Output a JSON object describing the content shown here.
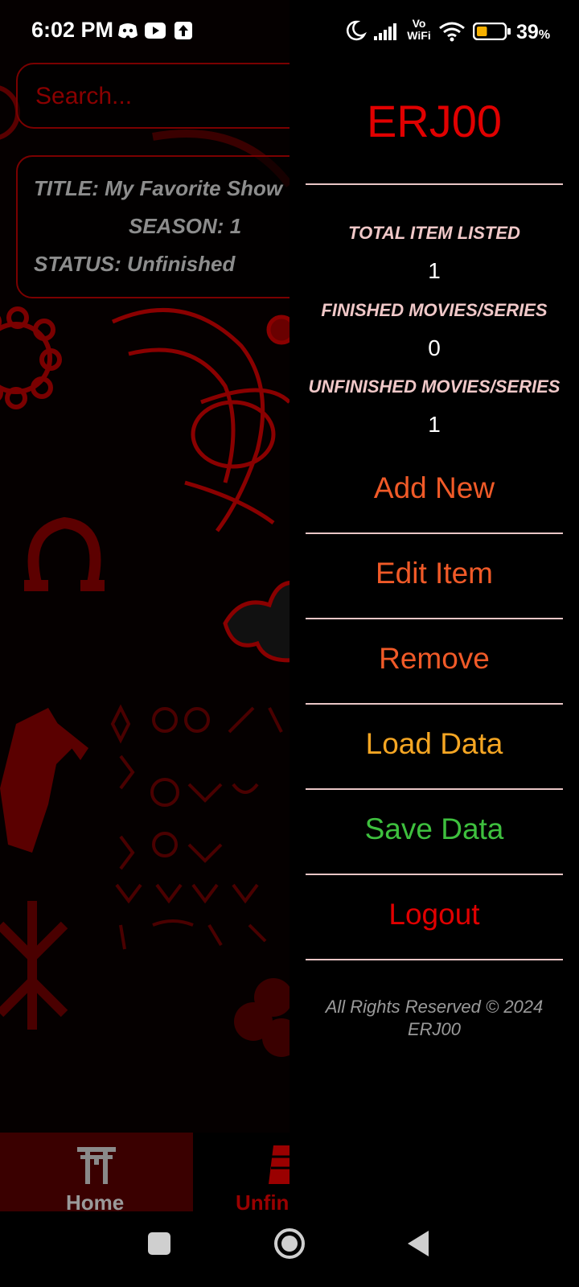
{
  "status_bar": {
    "time": "6:02 PM",
    "left_icons": [
      "discord-icon",
      "youtube-icon",
      "upload-icon"
    ],
    "right_icons": [
      "moon-icon",
      "signal-icon",
      "vowifi-icon",
      "wifi-icon",
      "battery-icon"
    ],
    "vowifi_top": "Vo",
    "vowifi_bottom": "WiFi",
    "battery_level": "39",
    "battery_unit": "%"
  },
  "background_app": {
    "search": {
      "placeholder": "Search..."
    },
    "item_card": {
      "title_label": "TITLE:",
      "title_value": "My Favorite Show",
      "season_label": "SEASON:",
      "season_value": "1",
      "status_label": "STATUS:",
      "status_value": "Unfinished"
    },
    "bottom_nav": {
      "home_label": "Home",
      "unfinished_label_partial": "Unfin"
    }
  },
  "drawer": {
    "username": "ERJ00",
    "stats": [
      {
        "label": "TOTAL ITEM LISTED",
        "value": "1"
      },
      {
        "label": "FINISHED MOVIES/SERIES",
        "value": "0"
      },
      {
        "label": "UNFINISHED MOVIES/SERIES",
        "value": "1"
      }
    ],
    "menu": [
      {
        "label": "Add New",
        "color": "#f05a28"
      },
      {
        "label": "Edit Item",
        "color": "#f05a28"
      },
      {
        "label": "Remove",
        "color": "#f05a28"
      },
      {
        "label": "Load Data",
        "color": "#f5a623"
      },
      {
        "label": "Save Data",
        "color": "#3ec03e"
      },
      {
        "label": "Logout",
        "color": "#e00000"
      }
    ],
    "copyright_line1": "All Rights Reserved © 2024",
    "copyright_line2": "ERJ00"
  },
  "system_nav": {
    "buttons": [
      "recents-square-icon",
      "home-circle-icon",
      "back-triangle-icon"
    ]
  },
  "colors": {
    "accent_red": "#e00000",
    "dark_red": "#7a0000",
    "divider": "#e9c6c6",
    "menu_orange": "#f05a28",
    "menu_amber": "#f5a623",
    "menu_green": "#3ec03e"
  }
}
